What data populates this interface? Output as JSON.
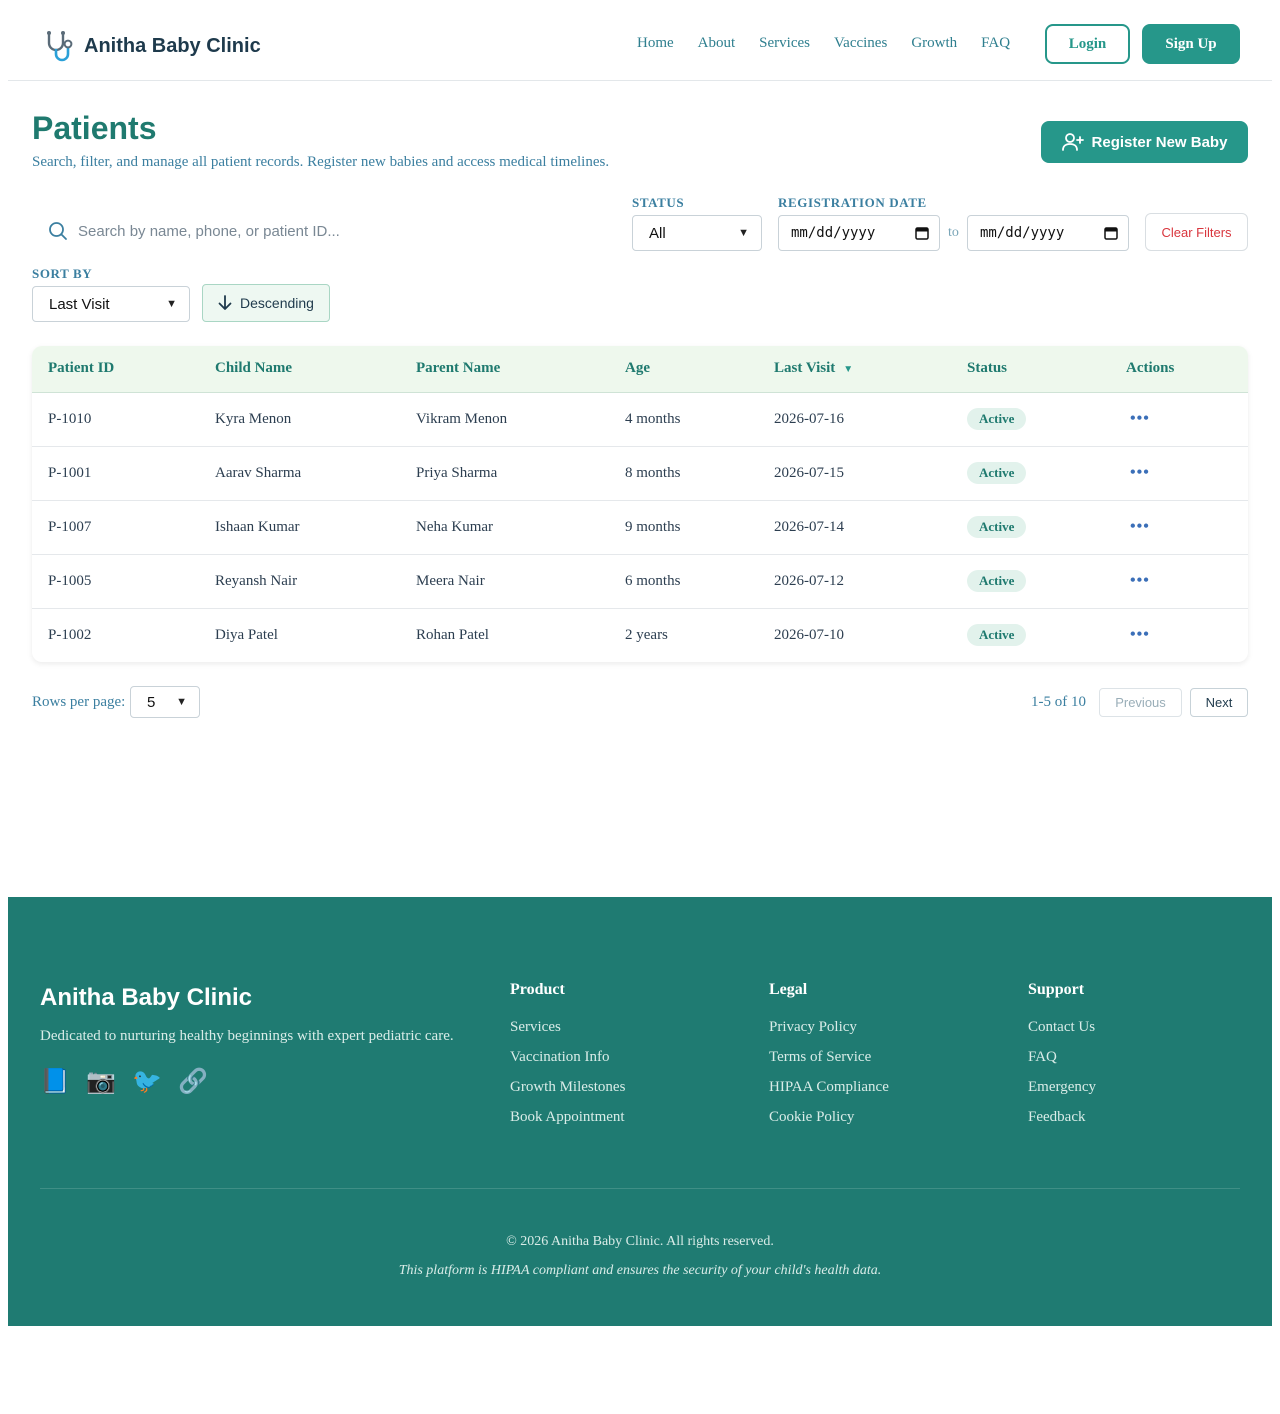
{
  "header": {
    "brand": "Anitha Baby Clinic",
    "nav": [
      "Home",
      "About",
      "Services",
      "Vaccines",
      "Growth",
      "FAQ"
    ],
    "login_label": "Login",
    "signup_label": "Sign Up"
  },
  "page": {
    "title": "Patients",
    "subtitle": "Search, filter, and manage all patient records. Register new babies and access medical timelines.",
    "register_label": "Register New Baby"
  },
  "filters": {
    "search_placeholder": "Search by name, phone, or patient ID...",
    "status_label": "STATUS",
    "status_value": "All",
    "registration_label": "REGISTRATION DATE",
    "date_from_placeholder": "mm/dd/yyyy",
    "date_to_placeholder": "mm/dd/yyyy",
    "to_label": "to",
    "clear_label": "Clear Filters",
    "sort_label": "SORT BY",
    "sort_value": "Last Visit",
    "order_label": "Descending"
  },
  "table": {
    "columns": [
      "Patient ID",
      "Child Name",
      "Parent Name",
      "Age",
      "Last Visit",
      "Status",
      "Actions"
    ],
    "sorted_indicator": "▼",
    "rows": [
      {
        "id": "P-1010",
        "child": "Kyra Menon",
        "parent": "Vikram Menon",
        "age": "4 months",
        "last_visit": "2026-07-16",
        "status": "Active"
      },
      {
        "id": "P-1001",
        "child": "Aarav Sharma",
        "parent": "Priya Sharma",
        "age": "8 months",
        "last_visit": "2026-07-15",
        "status": "Active"
      },
      {
        "id": "P-1007",
        "child": "Ishaan Kumar",
        "parent": "Neha Kumar",
        "age": "9 months",
        "last_visit": "2026-07-14",
        "status": "Active"
      },
      {
        "id": "P-1005",
        "child": "Reyansh Nair",
        "parent": "Meera Nair",
        "age": "6 months",
        "last_visit": "2026-07-12",
        "status": "Active"
      },
      {
        "id": "P-1002",
        "child": "Diya Patel",
        "parent": "Rohan Patel",
        "age": "2 years",
        "last_visit": "2026-07-10",
        "status": "Active"
      }
    ],
    "actions_glyph": "•••"
  },
  "pagination": {
    "rows_label": "Rows per page:",
    "rows_value": "5",
    "range": "1-5 of 10",
    "previous_label": "Previous",
    "next_label": "Next"
  },
  "footer": {
    "brand": "Anitha Baby Clinic",
    "tagline": "Dedicated to nurturing healthy beginnings with expert pediatric care.",
    "social": [
      {
        "icon": "facebook-icon",
        "glyph": "📘"
      },
      {
        "icon": "instagram-icon",
        "glyph": "📷"
      },
      {
        "icon": "twitter-icon",
        "glyph": "🐦"
      },
      {
        "icon": "link-icon",
        "glyph": "🔗"
      }
    ],
    "columns": [
      {
        "title": "Product",
        "links": [
          "Services",
          "Vaccination Info",
          "Growth Milestones",
          "Book Appointment"
        ]
      },
      {
        "title": "Legal",
        "links": [
          "Privacy Policy",
          "Terms of Service",
          "HIPAA Compliance",
          "Cookie Policy"
        ]
      },
      {
        "title": "Support",
        "links": [
          "Contact Us",
          "FAQ",
          "Emergency",
          "Feedback"
        ]
      }
    ],
    "copyright": "© 2026 Anitha Baby Clinic. All rights reserved.",
    "hipaa_note": "This platform is HIPAA compliant and ensures the security of your child's health data."
  },
  "colors": {
    "primary": "#26978a",
    "footer_bg": "#1f7b72",
    "danger": "#d9363e",
    "badge_bg": "#e2f2ec"
  }
}
